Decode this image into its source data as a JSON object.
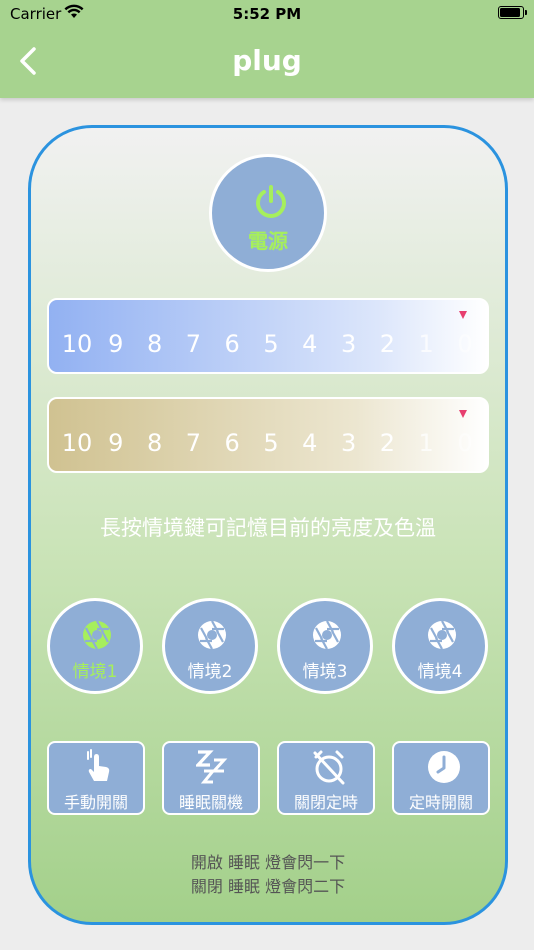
{
  "status_bar": {
    "carrier": "Carrier",
    "time": "5:52 PM"
  },
  "nav": {
    "title": "plug"
  },
  "power": {
    "label": "電源"
  },
  "brightness_slider": {
    "ticks": [
      "10",
      "9",
      "8",
      "7",
      "6",
      "5",
      "4",
      "3",
      "2",
      "1",
      "0"
    ],
    "selected": "0"
  },
  "color_slider": {
    "ticks": [
      "10",
      "9",
      "8",
      "7",
      "6",
      "5",
      "4",
      "3",
      "2",
      "1",
      "0"
    ],
    "selected": "0"
  },
  "hint": "長按情境鍵可記憶目前的亮度及色溫",
  "scenes": [
    {
      "label": "情境1",
      "active": true
    },
    {
      "label": "情境2",
      "active": false
    },
    {
      "label": "情境3",
      "active": false
    },
    {
      "label": "情境4",
      "active": false
    }
  ],
  "functions": [
    {
      "label": "手動開關",
      "icon": "hand-pointer-icon"
    },
    {
      "label": "睡眠關機",
      "icon": "sleep-zzz-icon"
    },
    {
      "label": "關閉定時",
      "icon": "alarm-off-icon"
    },
    {
      "label": "定時開關",
      "icon": "clock-icon"
    }
  ],
  "notes": [
    "開啟 睡眠 燈會閃一下",
    "關閉 睡眠 燈會閃二下"
  ],
  "colors": {
    "header": "#a7d38f",
    "accent_green": "#a6ef5c",
    "button_blue": "#8faed6",
    "card_border": "#2b93df",
    "marker": "#e73f6f"
  }
}
